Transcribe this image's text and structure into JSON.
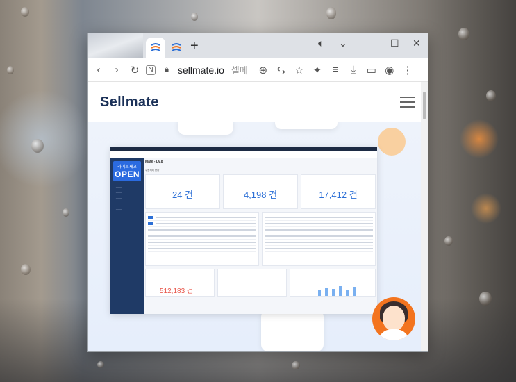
{
  "browser": {
    "url": "sellmate.io",
    "url_ghost": "셀메",
    "new_tab": "+",
    "controls": {
      "minimize": "—",
      "maximize": "☐",
      "close": "✕"
    }
  },
  "site": {
    "logo": "Sellmate",
    "dashboard": {
      "live_badge_top": "라이브재고",
      "live_badge": "OPEN",
      "header_title": "Mate - Lv.8",
      "section_title": "주문처리 현황",
      "cards": [
        {
          "value": "24 건"
        },
        {
          "value": "4,198 건"
        },
        {
          "value": "17,412 건"
        }
      ],
      "lower_value": "512,183 건"
    }
  },
  "colors": {
    "accent": "#2c6fd6",
    "brand": "#1b3158",
    "avatar": "#f3741f"
  }
}
